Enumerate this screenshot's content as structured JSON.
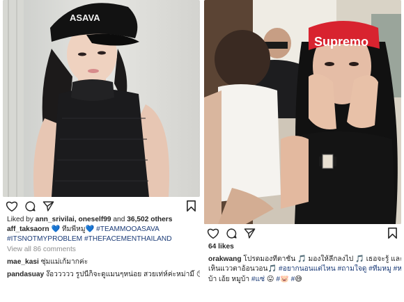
{
  "left_post": {
    "liked_by": {
      "prefix": "Liked by",
      "user1": "ann_srivilai,",
      "user2": "oneself99",
      "connector": "and",
      "count": "36,502 others"
    },
    "caption": {
      "username": "aff_taksaorn",
      "text": "💙 ทีมพี่หมู💙",
      "tags_line1": "#TEAMMOOASAVA",
      "tags_line2": "#ITSNOTMYPROBLEM #THEFACEMENTHAILAND"
    },
    "view_comments": "View all 86 comments",
    "comments": [
      {
        "username": "mae_kasi",
        "text": "ซุ่มแม่เก้มากค่ะ"
      },
      {
        "username": "pandasuay",
        "text": "ง๊อววววว รูปนี้ก็จะดูแมนๆหน่อย สวยเท่ห์ค่ะหม่ามี๊ 😘😱😍"
      }
    ],
    "photo_cap_text": "MOO ASAVA"
  },
  "right_post": {
    "likes": "64 likes",
    "caption": {
      "username": "orakwang",
      "text_line1": "โปรดมองที่ตาชั้น 🎵 มองให้ลึกลงไป 🎵 เธอจะรู้ และ",
      "text_line2": "เห็นแววตาอ้อนวอน🎵",
      "tag1": "#อยากนอนแต่ไหน",
      "tag2": "#ถามใจดู",
      "tag3": "#ทีมหมู",
      "tag4": "#หมู",
      "text_line3": "บ้า เอ้ย หมูบ้า",
      "tag5": "#แซ่",
      "emoji1": "😛",
      "tag6": "#",
      "emoji2": "🐷",
      "tag7": "#",
      "emoji3": "😅"
    },
    "headband_text": "Supremo"
  },
  "icons": [
    "heart-icon",
    "comment-icon",
    "share-icon",
    "bookmark-icon"
  ],
  "colors": {
    "hashtag": "#1b3b77",
    "muted": "#8e8e8e",
    "text": "#262626",
    "headband": "#d8232f"
  }
}
